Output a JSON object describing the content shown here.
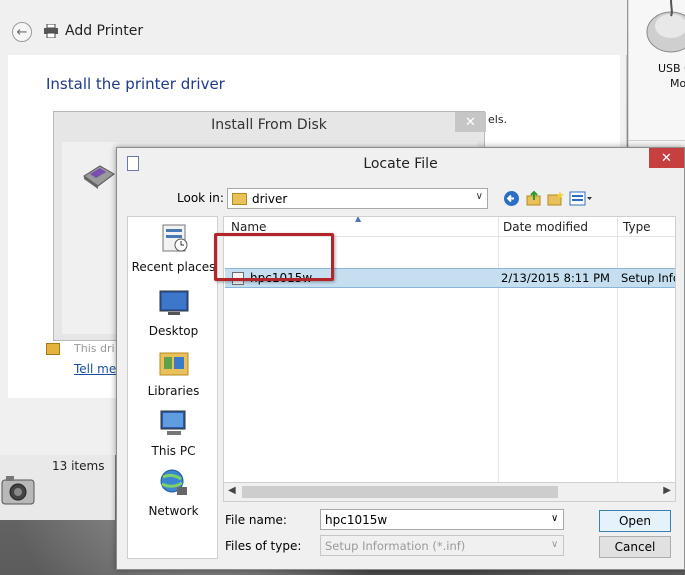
{
  "add_printer": {
    "title": "Add Printer",
    "heading": "Install the printer driver",
    "body_tail": "els.",
    "unsigned_note": "This dri",
    "tell_me_link": "Tell me"
  },
  "device_pane": {
    "label_line1": "USB C",
    "label_line2": "Mo"
  },
  "status": {
    "items_count": "13 items"
  },
  "install_from_disk": {
    "title": "Install From Disk",
    "close_glyph": "✕"
  },
  "locate_file": {
    "title": "Locate File",
    "close_glyph": "✕",
    "look_in_label": "Look in:",
    "look_in_value": "driver",
    "places": [
      {
        "label": "Recent places",
        "icon": "recent-places-icon"
      },
      {
        "label": "Desktop",
        "icon": "desktop-icon"
      },
      {
        "label": "Libraries",
        "icon": "libraries-icon"
      },
      {
        "label": "This PC",
        "icon": "this-pc-icon"
      },
      {
        "label": "Network",
        "icon": "network-icon"
      }
    ],
    "columns": [
      "Name",
      "Date modified",
      "Type"
    ],
    "files": [
      {
        "name": "hpc1015w",
        "date_modified": "2/13/2015 8:11 PM",
        "type": "Setup Info",
        "selected": true
      }
    ],
    "file_name_label": "File name:",
    "file_name_value": "hpc1015w",
    "files_of_type_label": "Files of type:",
    "files_of_type_value": "Setup Information (*.inf)",
    "open_label": "Open",
    "cancel_label": "Cancel"
  },
  "colors": {
    "selection": "#c5dff0",
    "highlight_box": "#b3252b",
    "heading_blue": "#1e3a8a",
    "close_red": "#c74040"
  }
}
